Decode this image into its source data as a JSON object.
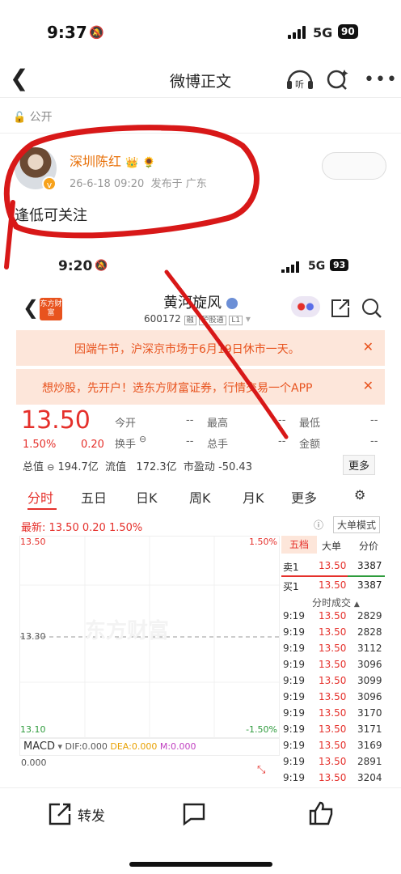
{
  "status": {
    "time": "9:37",
    "network": "5G",
    "battery": "90"
  },
  "header": {
    "title": "微博正文",
    "listen_label": "听"
  },
  "visibility": "公开",
  "post": {
    "username": "深圳陈红",
    "timestamp": "26-6-18 09:20",
    "location": "发布于 广东",
    "text": "逢低可关注"
  },
  "embedded": {
    "status": {
      "time": "9:20",
      "network": "5G",
      "battery": "93"
    },
    "logo": "东方财富",
    "stock_name": "黄河旋风",
    "stock_code": "600172",
    "tags": [
      "融",
      "沪股通",
      "L1"
    ],
    "banners": [
      "因端午节，沪深京市场于6月19日休市一天。",
      "想炒股，先开户！选东方财富证券，行情交易一个APP"
    ],
    "price": "13.50",
    "change_pct": "1.50%",
    "change_abs": "0.20",
    "quote": [
      [
        "今开",
        "--",
        "最高",
        "--",
        "最低",
        "--"
      ],
      [
        "换手",
        "--",
        "总手",
        "--",
        "金额",
        "--"
      ]
    ],
    "mktcap_label": "总值",
    "mktcap": "194.7亿",
    "float_label": "流值",
    "float": "172.3亿",
    "pe_label": "市盈动",
    "pe": "-50.43",
    "more_btn": "更多",
    "tabs": [
      "分时",
      "五日",
      "日K",
      "周K",
      "月K",
      "更多"
    ],
    "latest_line": "最新: 13.50  0.20  1.50%",
    "bigorder_btn": "大单模式",
    "chart_labels": {
      "top_left": "13.50",
      "top_right": "1.50%",
      "mid_left": "13.30",
      "bot_left": "13.10",
      "bot_right": "-1.50%",
      "zero": "0.000"
    },
    "macd": {
      "name": "MACD",
      "dif": "DIF:0.000",
      "dea": "DEA:0.000",
      "m": "M:0.000"
    },
    "book_tabs": [
      "五档",
      "大单",
      "分价"
    ],
    "sell1": {
      "label": "卖1",
      "price": "13.50",
      "vol": "3387"
    },
    "buy1": {
      "label": "买1",
      "price": "13.50",
      "vol": "3387"
    },
    "trades_title": "分时成交",
    "trades": [
      [
        "9:19",
        "13.50",
        "2829"
      ],
      [
        "9:19",
        "13.50",
        "2828"
      ],
      [
        "9:19",
        "13.50",
        "3112"
      ],
      [
        "9:19",
        "13.50",
        "3096"
      ],
      [
        "9:19",
        "13.50",
        "3099"
      ],
      [
        "9:19",
        "13.50",
        "3096"
      ],
      [
        "9:19",
        "13.50",
        "3170"
      ],
      [
        "9:19",
        "13.50",
        "3171"
      ],
      [
        "9:19",
        "13.50",
        "3169"
      ],
      [
        "9:19",
        "13.50",
        "2891"
      ],
      [
        "9:19",
        "13.50",
        "3204"
      ]
    ]
  },
  "bottom": {
    "repost_label": "转发"
  },
  "colors": {
    "annotation_red": "#d81818",
    "stock_red": "#e5302b",
    "weibo_orange": "#e8710a"
  }
}
